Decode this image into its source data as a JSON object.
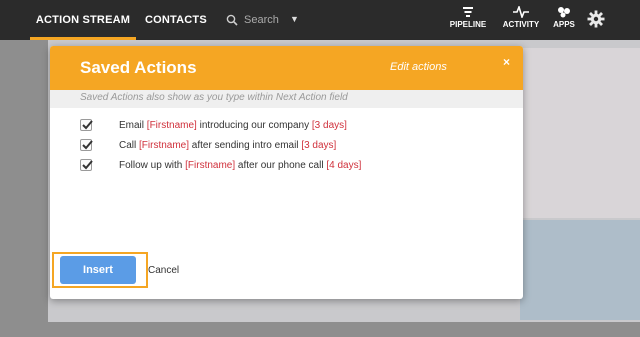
{
  "nav": {
    "tabs": [
      {
        "label": "ACTION STREAM",
        "active": true
      },
      {
        "label": "CONTACTS",
        "active": false
      }
    ],
    "search_placeholder": "Search",
    "right_items": [
      {
        "label": "PIPELINE",
        "icon": "pipeline-icon"
      },
      {
        "label": "ACTIVITY",
        "icon": "activity-icon"
      },
      {
        "label": "APPS",
        "icon": "apps-icon"
      }
    ]
  },
  "modal": {
    "title": "Saved Actions",
    "edit_link": "Edit actions",
    "close": "×",
    "hint": "Saved Actions also show as you type within Next Action field",
    "actions": [
      {
        "checked": true,
        "parts": [
          "Email ",
          "[Firstname]",
          " introducing our company ",
          "[3 days]"
        ]
      },
      {
        "checked": true,
        "parts": [
          "Call ",
          "[Firstname]",
          " after sending intro email ",
          "[3 days]"
        ]
      },
      {
        "checked": true,
        "parts": [
          "Follow up with ",
          "[Firstname]",
          " after our phone call ",
          "[4 days]"
        ]
      }
    ],
    "insert_label": "Insert",
    "cancel_label": "Cancel"
  },
  "colors": {
    "accent": "#f5a623",
    "nav_bg": "#2b2b2b",
    "variable_red": "#d0313c",
    "insert_blue": "#5b9ce6"
  }
}
